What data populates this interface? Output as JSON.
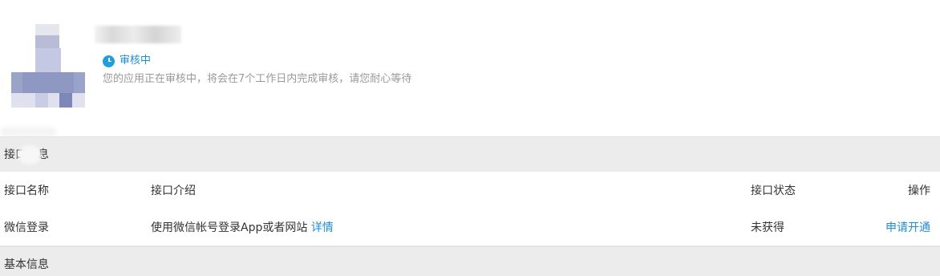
{
  "app": {
    "status_label": "审核中",
    "status_description": "您的应用正在审核中，将会在7个工作日内完成审核，请您耐心等待"
  },
  "sections": {
    "interface_title": "接口信息",
    "basic_title": "基本信息"
  },
  "table": {
    "headers": {
      "name": "接口名称",
      "description": "接口介绍",
      "status": "接口状态",
      "action": "操作"
    },
    "rows": [
      {
        "name": "微信登录",
        "description": "使用微信帐号登录App或者网站",
        "details_link": "详情",
        "status": "未获得",
        "action": "申请开通"
      }
    ]
  },
  "colors": {
    "accent": "#1e8fd6",
    "section_bg": "#ececec",
    "muted_text": "#999999"
  },
  "icons": {
    "status": "clock-icon"
  }
}
